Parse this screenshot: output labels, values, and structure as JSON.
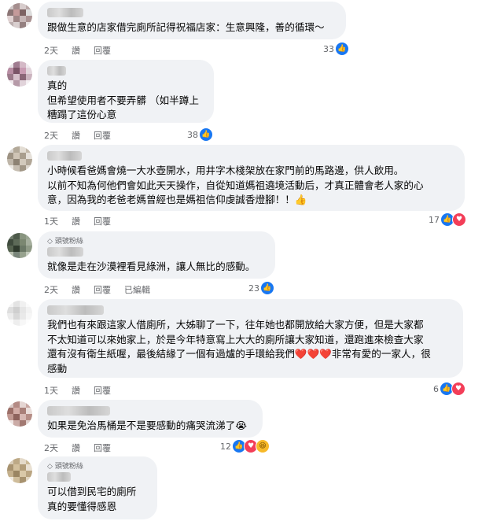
{
  "comments": [
    {
      "text": "跟做生意的店家借完廁所記得祝福店家：生意興隆，善的循環～",
      "time": "2天",
      "like": "讚",
      "reply": "回覆",
      "edited": "",
      "reaction_count": "33",
      "reactions": [
        "like-icon"
      ],
      "badge": ""
    },
    {
      "text": "真的\n但希望使用者不要弄髒 （如半蹲上\n糟蹋了這份心意",
      "time": "2天",
      "like": "讚",
      "reply": "回覆",
      "edited": "",
      "reaction_count": "38",
      "reactions": [
        "like-icon"
      ],
      "badge": ""
    },
    {
      "text": "小時候看爸媽會燒一大水壺開水，用井字木棧架放在家門前的馬路邊，供人飲用。\n以前不知為何他們會如此天天操作，自從知道媽祖遶境活動后，才真正體會老人家的心\n意，因為我的老爸老媽曾經也是媽祖信仰虔誠香燈腳！！👍",
      "time": "1天",
      "like": "讚",
      "reply": "回覆",
      "edited": "",
      "reaction_count": "17",
      "reactions": [
        "like-icon",
        "love-icon"
      ],
      "badge": ""
    },
    {
      "text": "就像是走在沙漠裡看見綠洲，讓人無比的感動。",
      "time": "2天",
      "like": "讚",
      "reply": "回覆",
      "edited": "已編輯",
      "reaction_count": "23",
      "reactions": [
        "like-icon"
      ],
      "badge": "頭號粉絲"
    },
    {
      "text": "我們也有來跟這家人借廁所，大姊聊了一下，往年她也都開放給大家方便，但是大家都\n不太知道可以來她家上，於是今年特意寫上大大的廁所讓大家知道，還跑進來檢查大家\n還有沒有衛生紙喔，最後結緣了一個有過爐的手環給我們❤️❤️❤️非常有愛的一家人，很\n感動",
      "time": "1天",
      "like": "讚",
      "reply": "回覆",
      "edited": "",
      "reaction_count": "6",
      "reactions": [
        "like-icon",
        "love-icon"
      ],
      "badge": ""
    },
    {
      "text": "如果是免治馬桶是不是要感動的痛哭流涕了😭",
      "time": "2天",
      "like": "讚",
      "reply": "回覆",
      "edited": "",
      "reaction_count": "12",
      "reactions": [
        "like-icon",
        "love-icon",
        "haha-icon"
      ],
      "badge": ""
    },
    {
      "text": "可以借到民宅的廁所\n真的要懂得感恩",
      "time": "",
      "like": "",
      "reply": "",
      "edited": "",
      "reaction_count": "",
      "reactions": [],
      "badge": "頭號粉絲"
    }
  ],
  "colors": {
    "bubble": "#f0f2f5",
    "meta_text": "#65676b",
    "like_blue": "#1877f2",
    "love_red": "#f33e58",
    "haha_yellow": "#f7b928"
  }
}
